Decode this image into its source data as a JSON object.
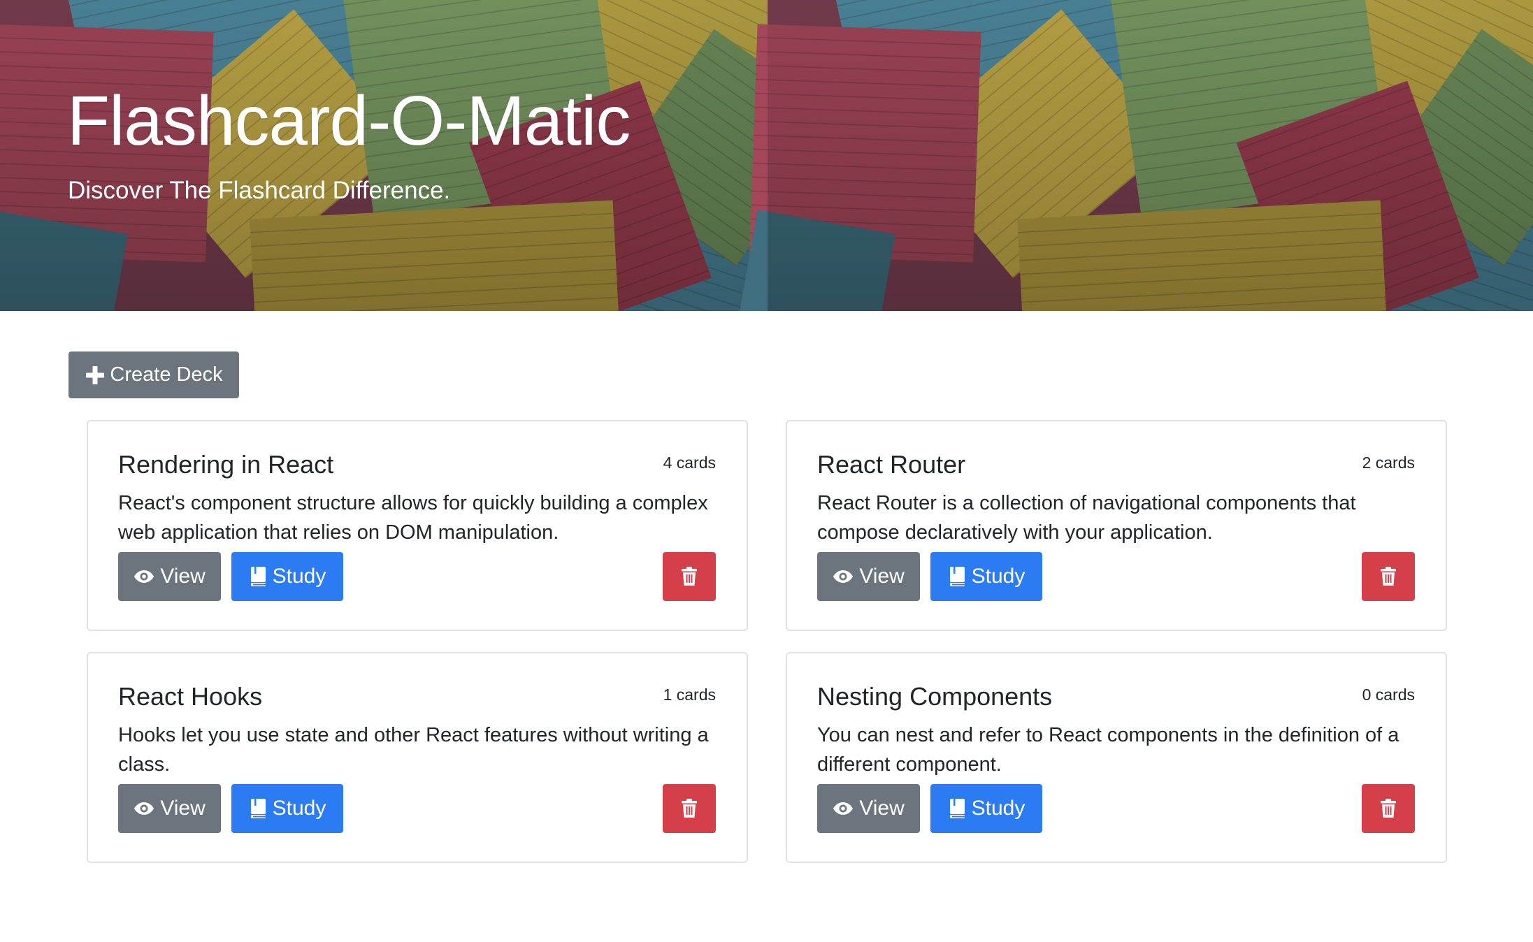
{
  "header": {
    "title": "Flashcard-O-Matic",
    "subtitle": "Discover The Flashcard Difference."
  },
  "actions": {
    "create_deck_label": "Create Deck",
    "create_deck_icon": "plus-icon"
  },
  "decks": [
    {
      "name": "Rendering in React",
      "count": "4 cards",
      "description": "React's component structure allows for quickly building a complex web application that relies on DOM manipulation.",
      "view_label": "View",
      "study_label": "Study"
    },
    {
      "name": "React Router",
      "count": "2 cards",
      "description": "React Router is a collection of navigational components that compose declaratively with your application.",
      "view_label": "View",
      "study_label": "Study"
    },
    {
      "name": "React Hooks",
      "count": "1 cards",
      "description": "Hooks let you use state and other React features without writing a class.",
      "view_label": "View",
      "study_label": "Study"
    },
    {
      "name": "Nesting Components",
      "count": "0 cards",
      "description": "You can nest and refer to React components in the definition of a different component.",
      "view_label": "View",
      "study_label": "Study"
    }
  ],
  "icons": {
    "view": "eye-icon",
    "study": "book-icon",
    "delete": "trash-icon"
  },
  "colors": {
    "secondary": "#6c757d",
    "primary": "#2b7bf3",
    "danger": "#d53f49",
    "border": "#dee2e6"
  }
}
